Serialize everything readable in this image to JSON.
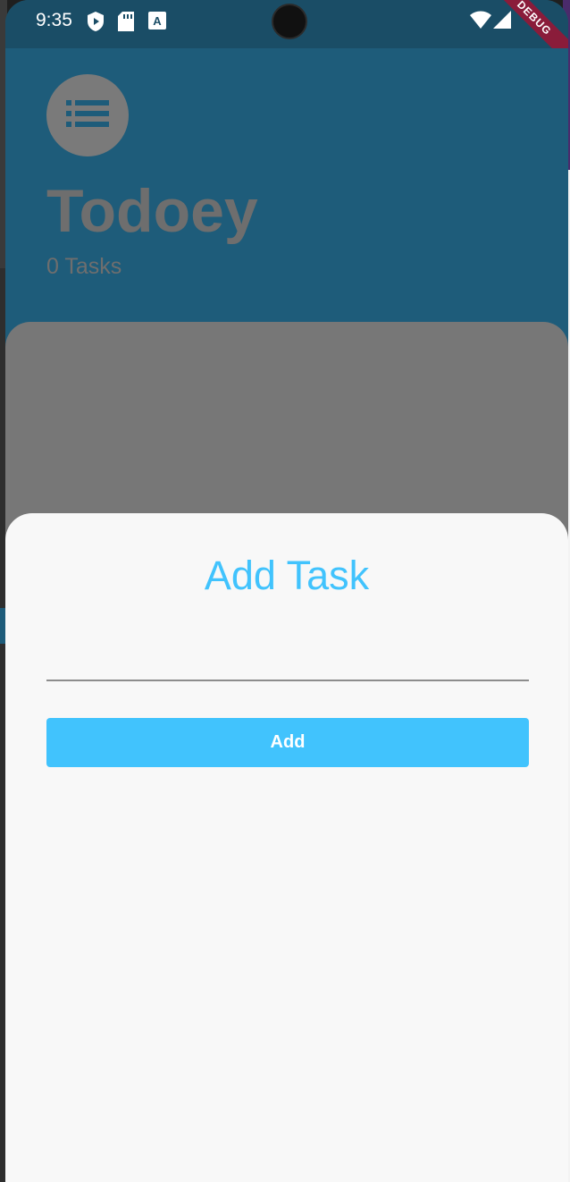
{
  "status_bar": {
    "time": "9:35",
    "icons": [
      "play-protect-icon",
      "sd-card-icon",
      "a-badge-icon",
      "wifi-icon",
      "signal-icon"
    ],
    "debug_label": "DEBUG"
  },
  "header": {
    "icon": "list-icon",
    "title": "Todoey",
    "task_count": "0 Tasks"
  },
  "add_task_sheet": {
    "title": "Add Task",
    "input_value": "",
    "input_placeholder": "",
    "add_button_label": "Add"
  },
  "colors": {
    "accent": "#41c3fd",
    "header_bg": "#1e5c7a",
    "overlay_grey": "#777777",
    "sheet_bg": "#f8f8f8"
  }
}
